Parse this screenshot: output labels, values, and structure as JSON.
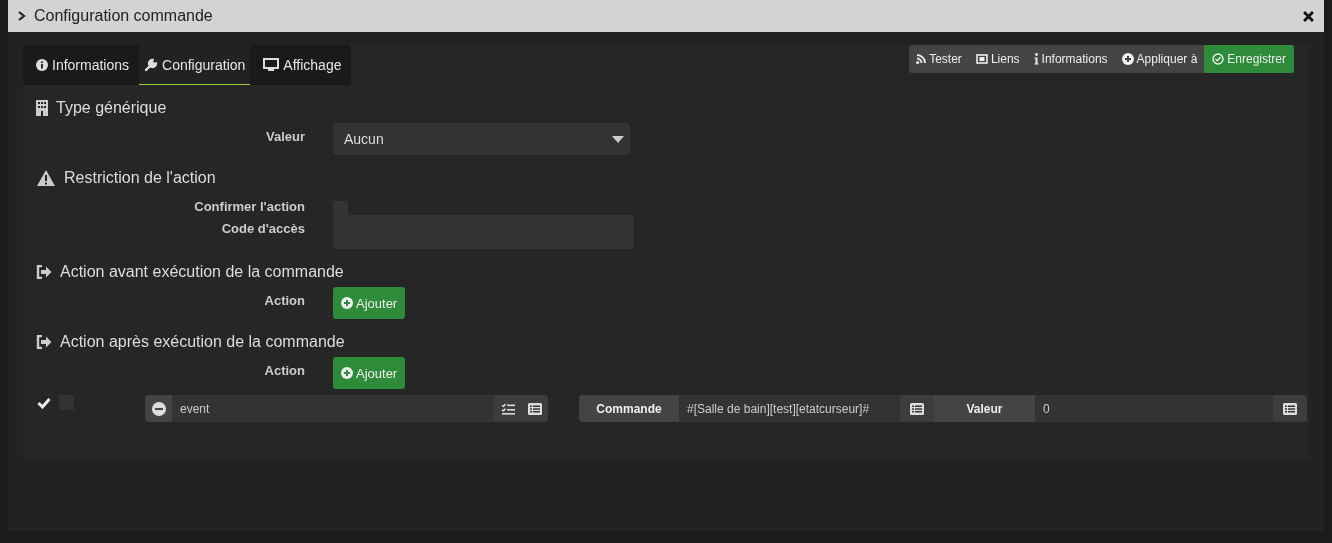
{
  "modal": {
    "title": "Configuration commande"
  },
  "tabs": [
    {
      "label": "Informations",
      "selected": false
    },
    {
      "label": "Configuration",
      "selected": true
    },
    {
      "label": "Affichage",
      "selected": false
    }
  ],
  "toolbar": [
    {
      "label": "Tester",
      "kind": "plain"
    },
    {
      "label": "Liens",
      "kind": "plain"
    },
    {
      "label": "Informations",
      "kind": "plain"
    },
    {
      "label": "Appliquer à",
      "kind": "plain"
    },
    {
      "label": "Enregistrer",
      "kind": "success"
    }
  ],
  "generic_type": {
    "heading": "Type générique",
    "label": "Valeur",
    "value": "Aucun"
  },
  "restriction": {
    "heading": "Restriction de l'action",
    "confirm_label": "Confirmer l'action",
    "confirm_checked": false,
    "code_label": "Code d'accès"
  },
  "before": {
    "heading": "Action avant exécution de la commande",
    "label": "Action",
    "button": "Ajouter"
  },
  "after": {
    "heading": "Action après exécution de la commande",
    "label": "Action",
    "button": "Ajouter",
    "rows": [
      {
        "enabled": true,
        "parallel": false,
        "action": "event",
        "command_label": "Commande",
        "command": "#[Salle de bain][test][etatcurseur]#",
        "value_label": "Valeur",
        "value": "0"
      }
    ]
  }
}
